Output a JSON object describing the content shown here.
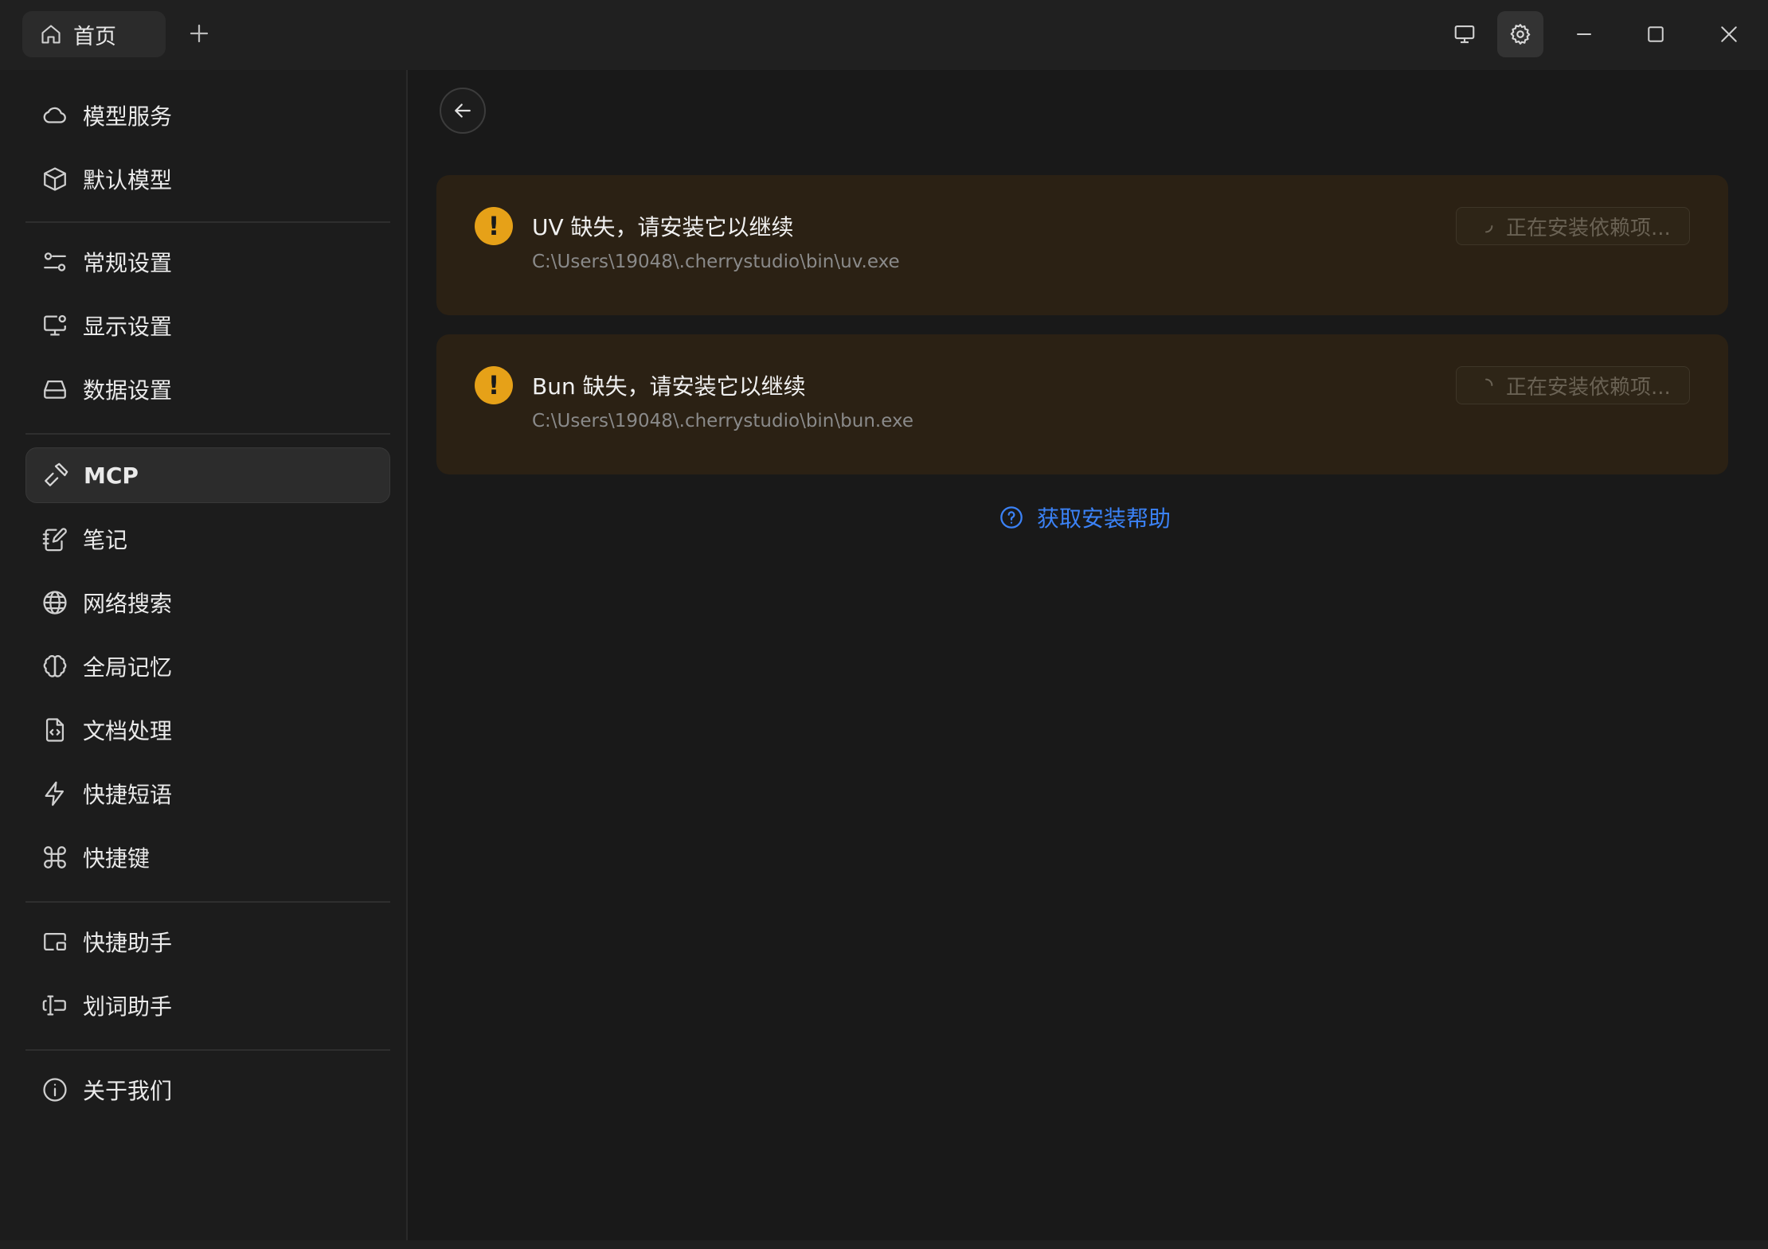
{
  "titlebar": {
    "home_tab_label": "首页"
  },
  "sidebar": {
    "items": [
      {
        "label": "模型服务"
      },
      {
        "label": "默认模型"
      },
      {
        "label": "常规设置"
      },
      {
        "label": "显示设置"
      },
      {
        "label": "数据设置"
      },
      {
        "label": "MCP"
      },
      {
        "label": "笔记"
      },
      {
        "label": "网络搜索"
      },
      {
        "label": "全局记忆"
      },
      {
        "label": "文档处理"
      },
      {
        "label": "快捷短语"
      },
      {
        "label": "快捷键"
      },
      {
        "label": "快捷助手"
      },
      {
        "label": "划词助手"
      },
      {
        "label": "关于我们"
      }
    ],
    "active_item": "MCP"
  },
  "main": {
    "alerts": [
      {
        "title": "UV 缺失，请安装它以继续",
        "path": "C:\\Users\\19048\\.cherrystudio\\bin\\uv.exe",
        "button_label": "正在安装依赖项..."
      },
      {
        "title": "Bun 缺失，请安装它以继续",
        "path": "C:\\Users\\19048\\.cherrystudio\\bin\\bun.exe",
        "button_label": "正在安装依赖项..."
      }
    ],
    "help_link_label": "获取安装帮助"
  },
  "colors": {
    "warning": "#e6a118",
    "alert_bg": "#2b2114",
    "link": "#3b82f6",
    "background": "#191919"
  }
}
